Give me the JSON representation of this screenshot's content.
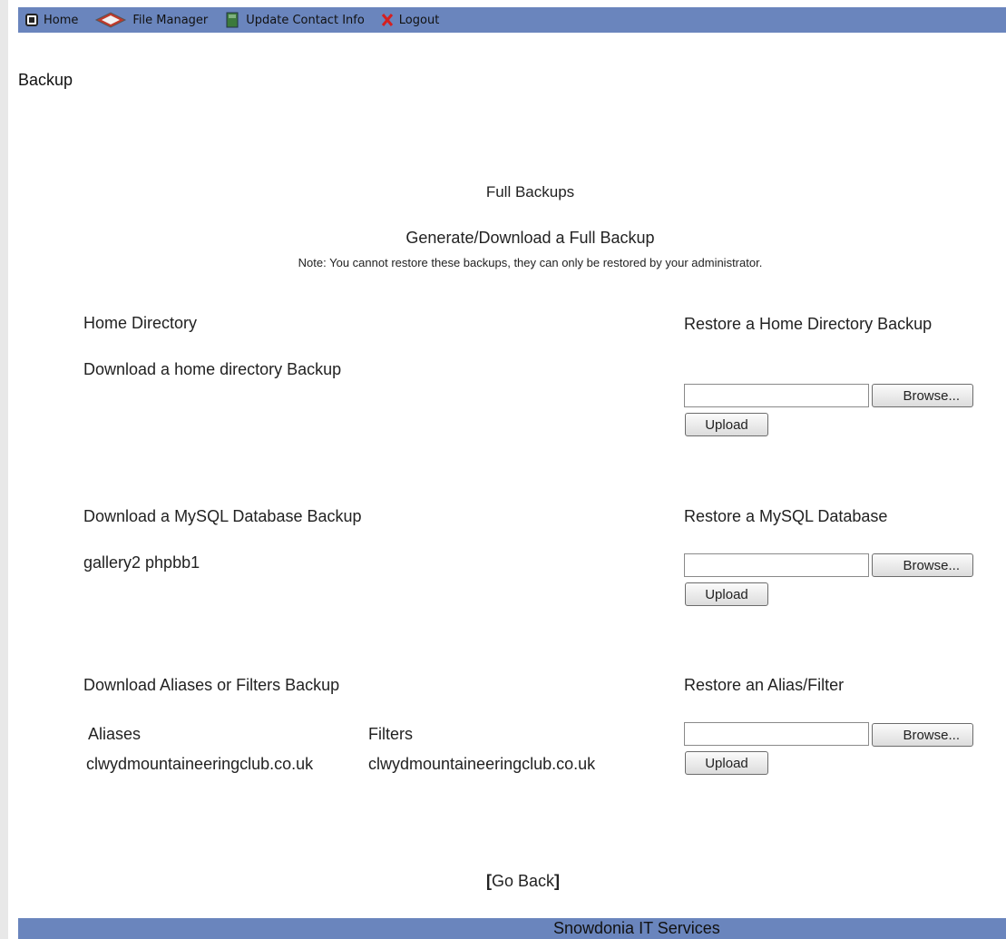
{
  "nav": {
    "home_label": "Home",
    "file_manager_label": "File Manager",
    "update_contact_label": "Update Contact Info",
    "logout_label": "Logout"
  },
  "page": {
    "title": "Backup"
  },
  "full_backups": {
    "heading": "Full Backups",
    "generate_link": "Generate/Download a Full Backup",
    "note": "Note: You cannot restore these backups, they can only be restored by your administrator."
  },
  "home_directory": {
    "heading": "Home Directory",
    "download_link": "Download a home directory Backup",
    "restore_heading": "Restore a Home Directory Backup"
  },
  "mysql": {
    "download_heading": "Download a MySQL Database Backup",
    "databases": "gallery2 phpbb1",
    "restore_heading": "Restore a MySQL Database"
  },
  "aliases": {
    "download_heading": "Download Aliases or Filters Backup",
    "aliases_header": "Aliases",
    "filters_header": "Filters",
    "alias_domain": "clwydmountaineeringclub.co.uk",
    "filter_domain": "clwydmountaineeringclub.co.uk",
    "restore_heading": "Restore an Alias/Filter"
  },
  "buttons": {
    "browse": "Browse...",
    "upload": "Upload"
  },
  "go_back": {
    "open": "[",
    "label": "Go Back",
    "close": "]"
  },
  "footer": {
    "text": "Snowdonia IT Services"
  },
  "colors": {
    "nav_bg": "#6a85bd",
    "footer_bg": "#6a85bd"
  }
}
